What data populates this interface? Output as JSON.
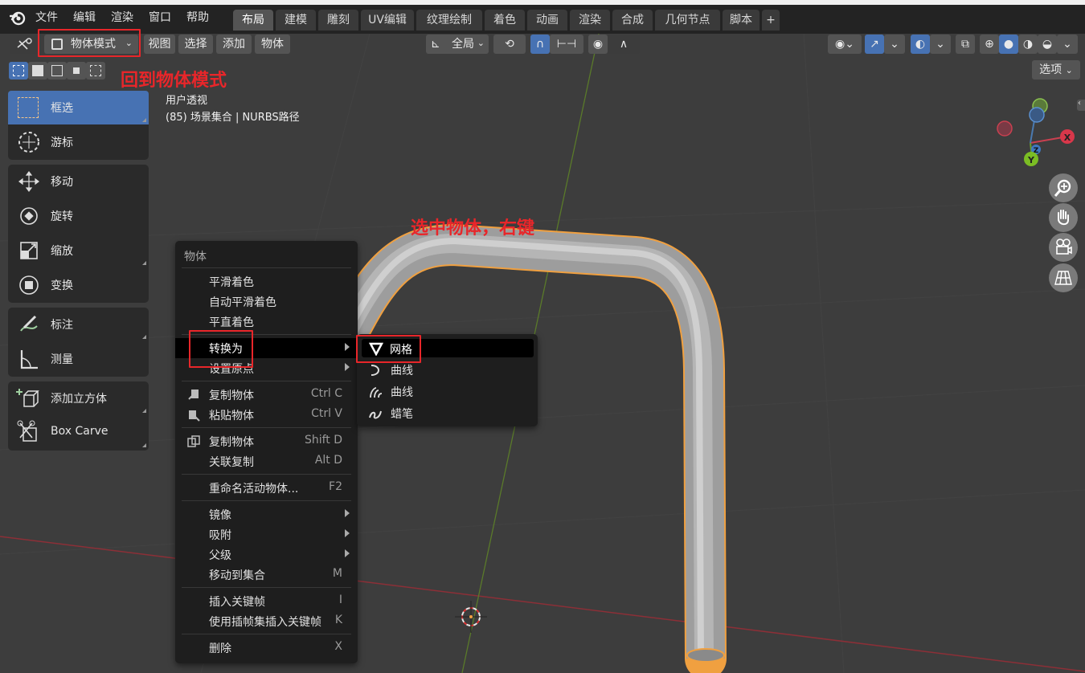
{
  "menubar": {
    "items": [
      "文件",
      "编辑",
      "渲染",
      "窗口",
      "帮助"
    ],
    "workspace_tabs": [
      "布局",
      "建模",
      "雕刻",
      "UV编辑",
      "纹理绘制",
      "着色",
      "动画",
      "渲染",
      "合成",
      "几何节点",
      "脚本"
    ],
    "active_tab": "布局",
    "add_tab": "+"
  },
  "header": {
    "mode": "物体模式",
    "menus": [
      "视图",
      "选择",
      "添加",
      "物体"
    ],
    "orientation": "全局",
    "options": "选项"
  },
  "annotations": {
    "mode_note": "回到物体模式",
    "select_note": "选中物体，右键"
  },
  "viewport": {
    "view_name": "用户透视",
    "object_info": "(85) 场景集合 | NURBS路径"
  },
  "toolbar": {
    "items": [
      "框选",
      "游标",
      "移动",
      "旋转",
      "缩放",
      "变换",
      "标注",
      "测量",
      "添加立方体",
      "Box Carve"
    ]
  },
  "gizmo": {
    "x": "X",
    "y": "Y",
    "z": "Z"
  },
  "context_menu": {
    "title": "物体",
    "items": [
      {
        "label": "平滑着色",
        "shortcut": ""
      },
      {
        "label": "自动平滑着色",
        "shortcut": ""
      },
      {
        "label": "平直着色",
        "shortcut": ""
      },
      {
        "label": "转换为",
        "shortcut": ""
      },
      {
        "label": "设置原点",
        "shortcut": ""
      },
      {
        "label": "复制物体",
        "shortcut": "Ctrl C"
      },
      {
        "label": "粘贴物体",
        "shortcut": "Ctrl V"
      },
      {
        "label": "复制物体",
        "shortcut": "Shift D"
      },
      {
        "label": "关联复制",
        "shortcut": "Alt D"
      },
      {
        "label": "重命名活动物体...",
        "shortcut": "F2"
      },
      {
        "label": "镜像",
        "shortcut": ""
      },
      {
        "label": "吸附",
        "shortcut": ""
      },
      {
        "label": "父级",
        "shortcut": ""
      },
      {
        "label": "移动到集合",
        "shortcut": "M"
      },
      {
        "label": "插入关键帧",
        "shortcut": "I"
      },
      {
        "label": "使用插帧集插入关键帧",
        "shortcut": "K"
      },
      {
        "label": "删除",
        "shortcut": "X"
      }
    ]
  },
  "convert_submenu": {
    "items": [
      "网格",
      "曲线",
      "曲线",
      "蜡笔"
    ]
  },
  "colors": {
    "accent": "#4772b3",
    "annotation_red": "#e8262a",
    "selection_outline": "#f0a040",
    "viewport_bg": "#3d3d3d"
  }
}
